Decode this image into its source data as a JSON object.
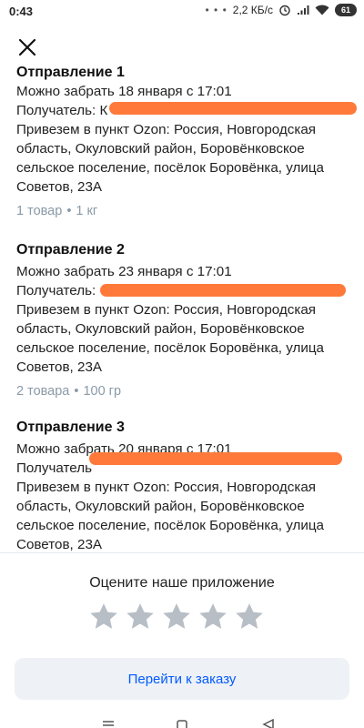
{
  "status_bar": {
    "time": "0:43",
    "dots": "• • •",
    "speed": "2,2 КБ/с",
    "battery": "61"
  },
  "shipments": [
    {
      "title": "Отправление 1",
      "pickup": "Можно забрать 18 января с 17:01",
      "recipient_label": "Получатель: К",
      "delivery_lines": [
        "Привезем в пункт Ozon: Россия, Новгородская",
        "область, Окуловский район, Боровёнковское",
        "сельское поселение, посёлок Боровёнка, улица",
        "Советов, 23А"
      ],
      "items": "1 товар",
      "weight": "1 кг"
    },
    {
      "title": "Отправление 2",
      "pickup": "Можно забрать 23 января с 17:01",
      "recipient_label": "Получатель: ",
      "delivery_lines": [
        "Привезем в пункт Ozon: Россия, Новгородская",
        "область, Окуловский район, Боровёнковское",
        "сельское поселение, посёлок Боровёнка, улица",
        "Советов, 23А"
      ],
      "items": "2 товара",
      "weight": "100 гр"
    },
    {
      "title": "Отправление 3",
      "pickup": "Можно забрать 20 января с 17:01",
      "recipient_label": "Получатель",
      "delivery_lines": [
        "Привезем в пункт Ozon: Россия, Новгородская",
        "область, Окуловский район, Боровёнковское",
        "сельское поселение, посёлок Боровёнка, улица",
        "Советов, 23А"
      ]
    }
  ],
  "rating": {
    "title": "Оцените наше приложение",
    "stars": 5
  },
  "order_button": "Перейти к заказу",
  "colors": {
    "accent": "#005bff",
    "redaction": "#ff7a3a",
    "star": "#b7bec6"
  }
}
